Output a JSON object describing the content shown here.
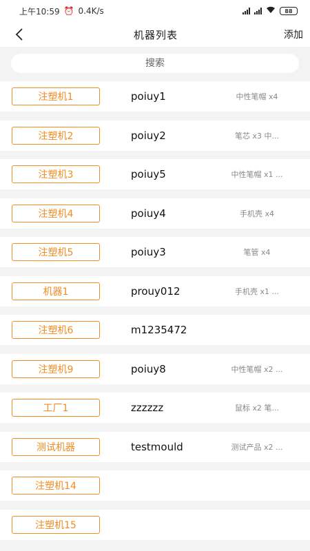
{
  "status": {
    "time": "上午10:59",
    "speed": "0.4K/s",
    "battery": "88"
  },
  "nav": {
    "title": "机器列表",
    "action": "添加"
  },
  "search": {
    "placeholder": "搜索"
  },
  "machines": [
    {
      "name": "注塑机1",
      "mold": "poiuy1",
      "products": "中性笔帽 x4"
    },
    {
      "name": "注塑机2",
      "mold": "poiuy2",
      "products": "笔芯 x3  中..."
    },
    {
      "name": "注塑机3",
      "mold": "poiuy5",
      "products": "中性笔帽 x1  ..."
    },
    {
      "name": "注塑机4",
      "mold": "poiuy4",
      "products": "手机壳 x4"
    },
    {
      "name": "注塑机5",
      "mold": "poiuy3",
      "products": "笔管 x4"
    },
    {
      "name": "机器1",
      "mold": "prouy012",
      "products": "手机壳 x1  ..."
    },
    {
      "name": "注塑机6",
      "mold": "m1235472",
      "products": ""
    },
    {
      "name": "注塑机9",
      "mold": "poiuy8",
      "products": "中性笔帽 x2  ..."
    },
    {
      "name": "工厂1",
      "mold": "zzzzzz",
      "products": "鼠标 x2  笔..."
    },
    {
      "name": "测试机器",
      "mold": "testmould",
      "products": "测试产品 x2  ..."
    },
    {
      "name": "注塑机14",
      "mold": "",
      "products": ""
    },
    {
      "name": "注塑机15",
      "mold": "",
      "products": ""
    }
  ]
}
